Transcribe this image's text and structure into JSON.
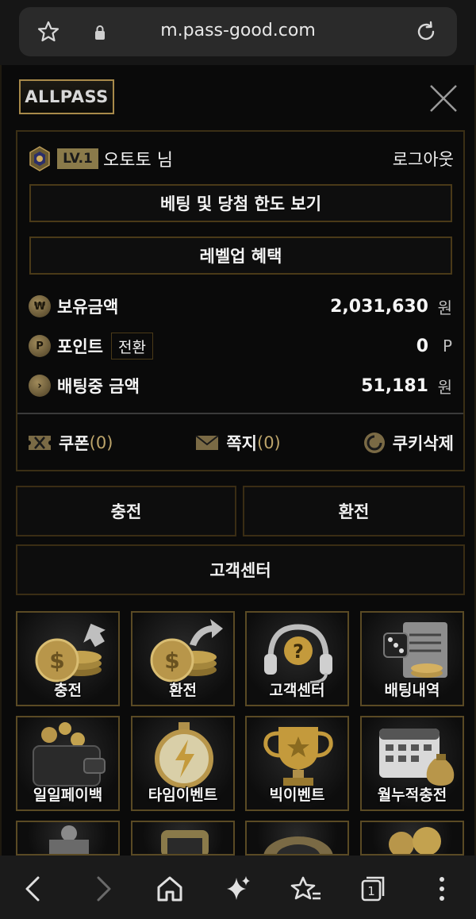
{
  "browser": {
    "url": "m.pass-good.com",
    "tab_count": "1"
  },
  "panel": {
    "logo_text": "ALLPASS",
    "user": {
      "level": "LV.1",
      "name": "오토토 님",
      "logout": "로그아웃"
    },
    "buttons": {
      "limits": "베팅 및 당첨 한도 보기",
      "levelup": "레벨업 혜택"
    },
    "balances": [
      {
        "coin": "₩",
        "label": "보유금액",
        "value": "2,031,630",
        "unit": "원"
      },
      {
        "coin": "P",
        "label": "포인트",
        "swap": "전환",
        "value": "0",
        "unit": "P"
      },
      {
        "coin": "›",
        "label": "배팅중 금액",
        "value": "51,181",
        "unit": "원"
      }
    ],
    "bottom": {
      "coupon_label": "쿠폰",
      "coupon_count": "(0)",
      "message_label": "쪽지",
      "message_count": "(0)",
      "cookie_label": "쿠키삭제"
    },
    "actions": {
      "deposit": "충전",
      "withdraw": "환전",
      "support": "고객센터"
    },
    "tiles": [
      {
        "label": "충전",
        "icon": "coins-in-icon"
      },
      {
        "label": "환전",
        "icon": "coins-out-icon"
      },
      {
        "label": "고객센터",
        "icon": "headset-icon"
      },
      {
        "label": "배팅내역",
        "icon": "dice-document-icon"
      },
      {
        "label": "일일페이백",
        "icon": "wallet-coins-icon"
      },
      {
        "label": "타임이벤트",
        "icon": "stopwatch-icon"
      },
      {
        "label": "빅이벤트",
        "icon": "trophy-icon"
      },
      {
        "label": "월누적충전",
        "icon": "calendar-moneybag-icon"
      }
    ]
  },
  "colors": {
    "gold_border": "#4a3a18",
    "gold_accent": "#bca46a",
    "background": "#0a0a0a"
  }
}
